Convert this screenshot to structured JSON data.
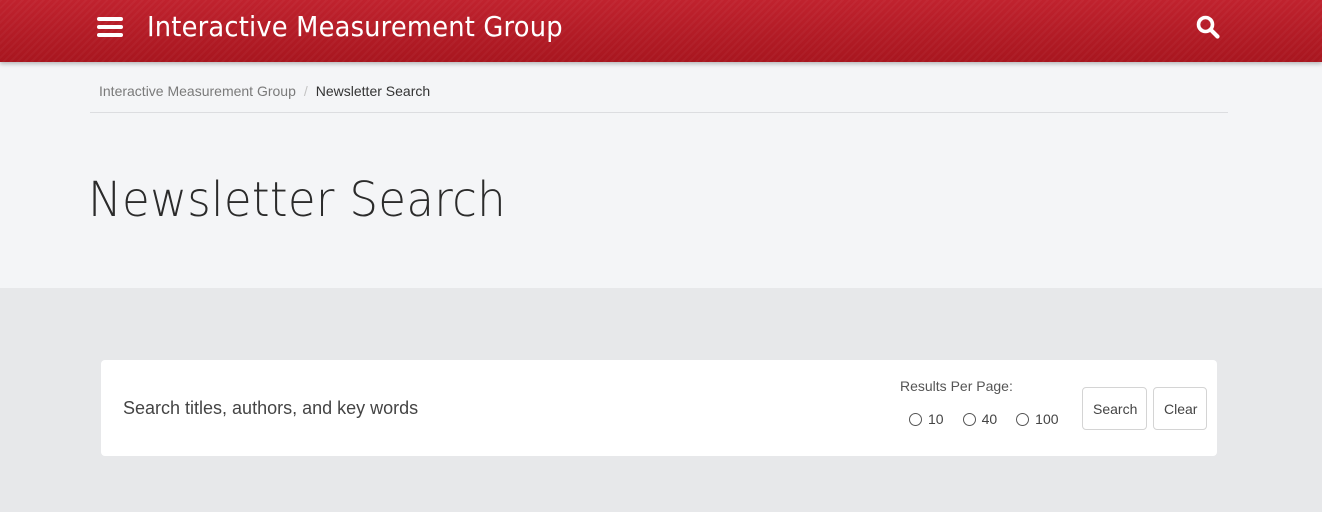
{
  "header": {
    "site_title": "Interactive Measurement Group",
    "menu_icon": "hamburger-menu-icon",
    "search_icon": "search-icon",
    "brand_color": "#b31b25"
  },
  "breadcrumb": {
    "items": [
      "Interactive Measurement Group",
      "Newsletter Search"
    ],
    "separator": "/"
  },
  "page": {
    "title": "Newsletter Search"
  },
  "search": {
    "placeholder": "Search titles, authors, and key words",
    "value": "",
    "results_per_page_label": "Results Per Page:",
    "results_per_page_options": [
      "10",
      "40",
      "100"
    ],
    "search_button": "Search",
    "clear_button": "Clear"
  }
}
